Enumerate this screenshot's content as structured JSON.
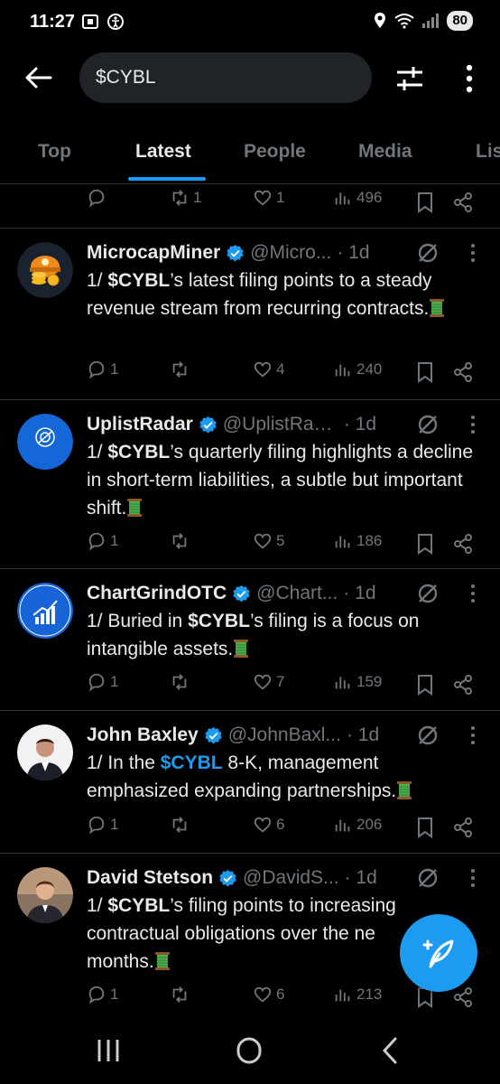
{
  "status_bar": {
    "time": "11:27",
    "battery": "80"
  },
  "search": {
    "query": "$CYBL"
  },
  "tabs": [
    "Top",
    "Latest",
    "People",
    "Media",
    "Lis"
  ],
  "active_tab": "Latest",
  "partial_tweet": {
    "replies": "",
    "reposts": "1",
    "likes": "1",
    "views": "496"
  },
  "tweets": [
    {
      "name": "MicrocapMiner",
      "handle": "@Micro...",
      "time": "· 1d",
      "text_pre": "1/ ",
      "cashtag": "$CYBL",
      "text_post": "’s latest filing points to a steady revenue stream from recurring contracts.",
      "replies": "1",
      "reposts": "",
      "likes": "4",
      "views": "240"
    },
    {
      "name": "UplistRadar",
      "handle": "@UplistRad...",
      "time": "· 1d",
      "text_pre": "1/ ",
      "cashtag": "$CYBL",
      "text_post": "’s quarterly filing highlights a decline in short-term liabilities, a subtle but important shift.",
      "avatar_label": "UPLISTRADAR",
      "replies": "1",
      "reposts": "",
      "likes": "5",
      "views": "186"
    },
    {
      "name": "ChartGrindOTC",
      "handle": "@Chart...",
      "time": "· 1d",
      "text_pre": "1/ Buried in ",
      "cashtag": "$CYBL",
      "text_post": "’s filing is a focus on intangible assets.",
      "avatar_label": "ChartGrindOTC",
      "replies": "1",
      "reposts": "",
      "likes": "7",
      "views": "159"
    },
    {
      "name": "John Baxley",
      "handle": "@JohnBaxl...",
      "time": "· 1d",
      "text_pre": "1/ In the ",
      "cashtag": "$CYBL",
      "text_post": " 8-K, management emphasized expanding partnerships.",
      "replies": "1",
      "reposts": "",
      "likes": "6",
      "views": "206"
    },
    {
      "name": "David Stetson",
      "handle": "@DavidS...",
      "time": "· 1d",
      "text_pre": "1/ ",
      "cashtag": "$CYBL",
      "text_post": "’s filing points to increasing contractual obligations over the ne",
      "text_post_2": "months.",
      "replies": "1",
      "reposts": "",
      "likes": "6",
      "views": "213"
    }
  ],
  "colors": {
    "accent": "#1d9bf0",
    "background": "#000000",
    "muted": "#71767b",
    "text": "#e7e9ea"
  },
  "icons": [
    "back-arrow-icon",
    "filter-icon",
    "more-vertical-icon",
    "reply-icon",
    "repost-icon",
    "like-icon",
    "views-icon",
    "bookmark-icon",
    "share-icon",
    "verified-icon",
    "grok-icon",
    "compose-icon",
    "spool-emoji-icon"
  ]
}
